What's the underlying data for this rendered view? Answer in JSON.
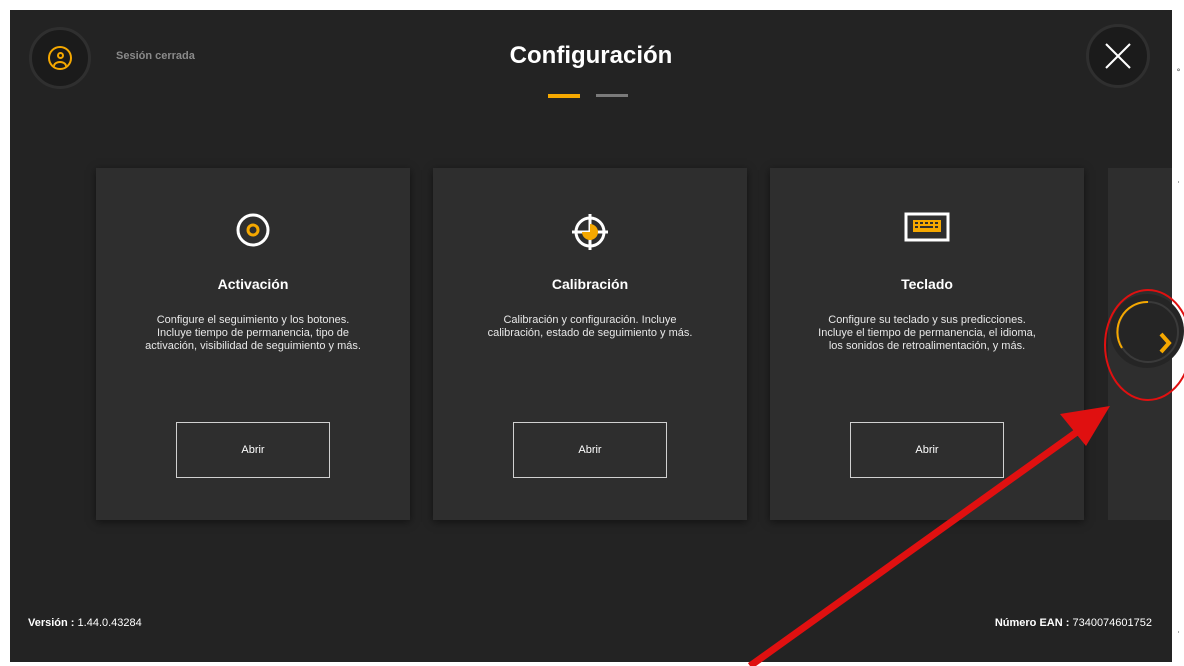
{
  "header": {
    "session_status": "Sesión cerrada",
    "title": "Configuración",
    "page_indicator": {
      "current": 1,
      "total": 2
    }
  },
  "cards": [
    {
      "title": "Activación",
      "description_lines": [
        "Configure el seguimiento y los botones.",
        "Incluye tiempo de permanencia, tipo de",
        "activación, visibilidad de seguimiento y más."
      ],
      "button_label": "Abrir",
      "icon": "target-dot-icon"
    },
    {
      "title": "Calibración",
      "description_lines": [
        "Calibración y configuración. Incluye",
        "calibración, estado de seguimiento y más."
      ],
      "button_label": "Abrir",
      "icon": "crosshair-icon"
    },
    {
      "title": "Teclado",
      "description_lines": [
        "Configure su teclado y sus predicciones.",
        "Incluye el tiempo de permanencia, el idioma,",
        "los sonidos de retroalimentación, y más."
      ],
      "button_label": "Abrir",
      "icon": "keyboard-icon"
    }
  ],
  "footer": {
    "version_label": "Versión",
    "version_value": "1.44.0.43284",
    "ean_label": "Número EAN",
    "ean_value": "7340074601752"
  },
  "colors": {
    "accent": "#f5a800",
    "background": "#232323",
    "card": "#2e2e2e",
    "annotation": "#e01010"
  }
}
